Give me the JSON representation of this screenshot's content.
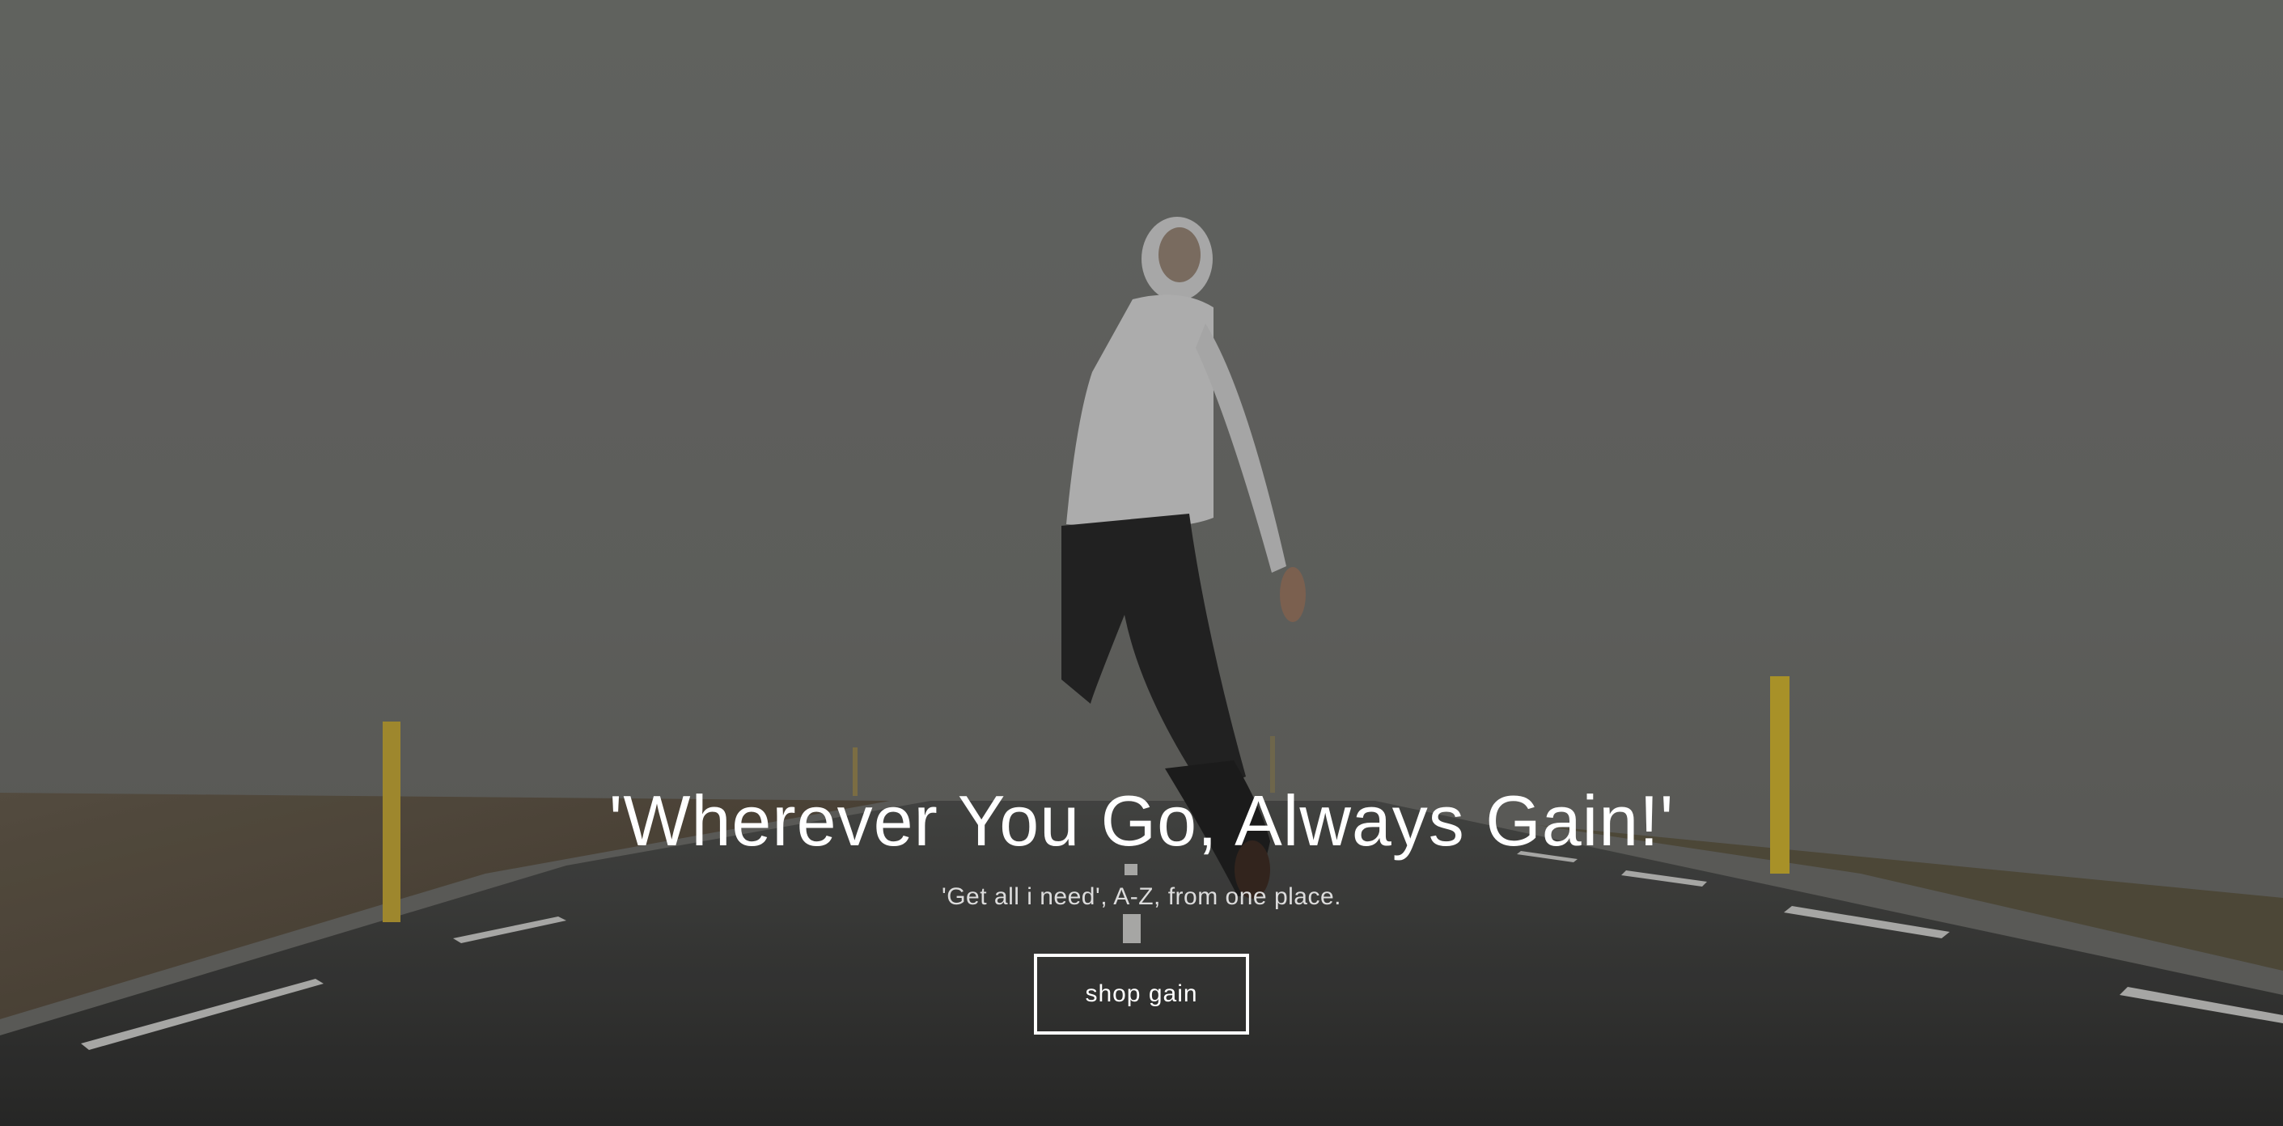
{
  "hero": {
    "heading": "'Wherever You Go, Always Gain!'",
    "subheading": "'Get all i need', A-Z, from one place.",
    "button_label": "shop gain",
    "background_image": "foggy-road-jumping-man-photo"
  },
  "colors": {
    "overlay": "#5a5b58",
    "text": "#ffffff",
    "subtext": "#dcdcdc",
    "button_border": "#ffffff",
    "road_marker": "#c9a632"
  }
}
